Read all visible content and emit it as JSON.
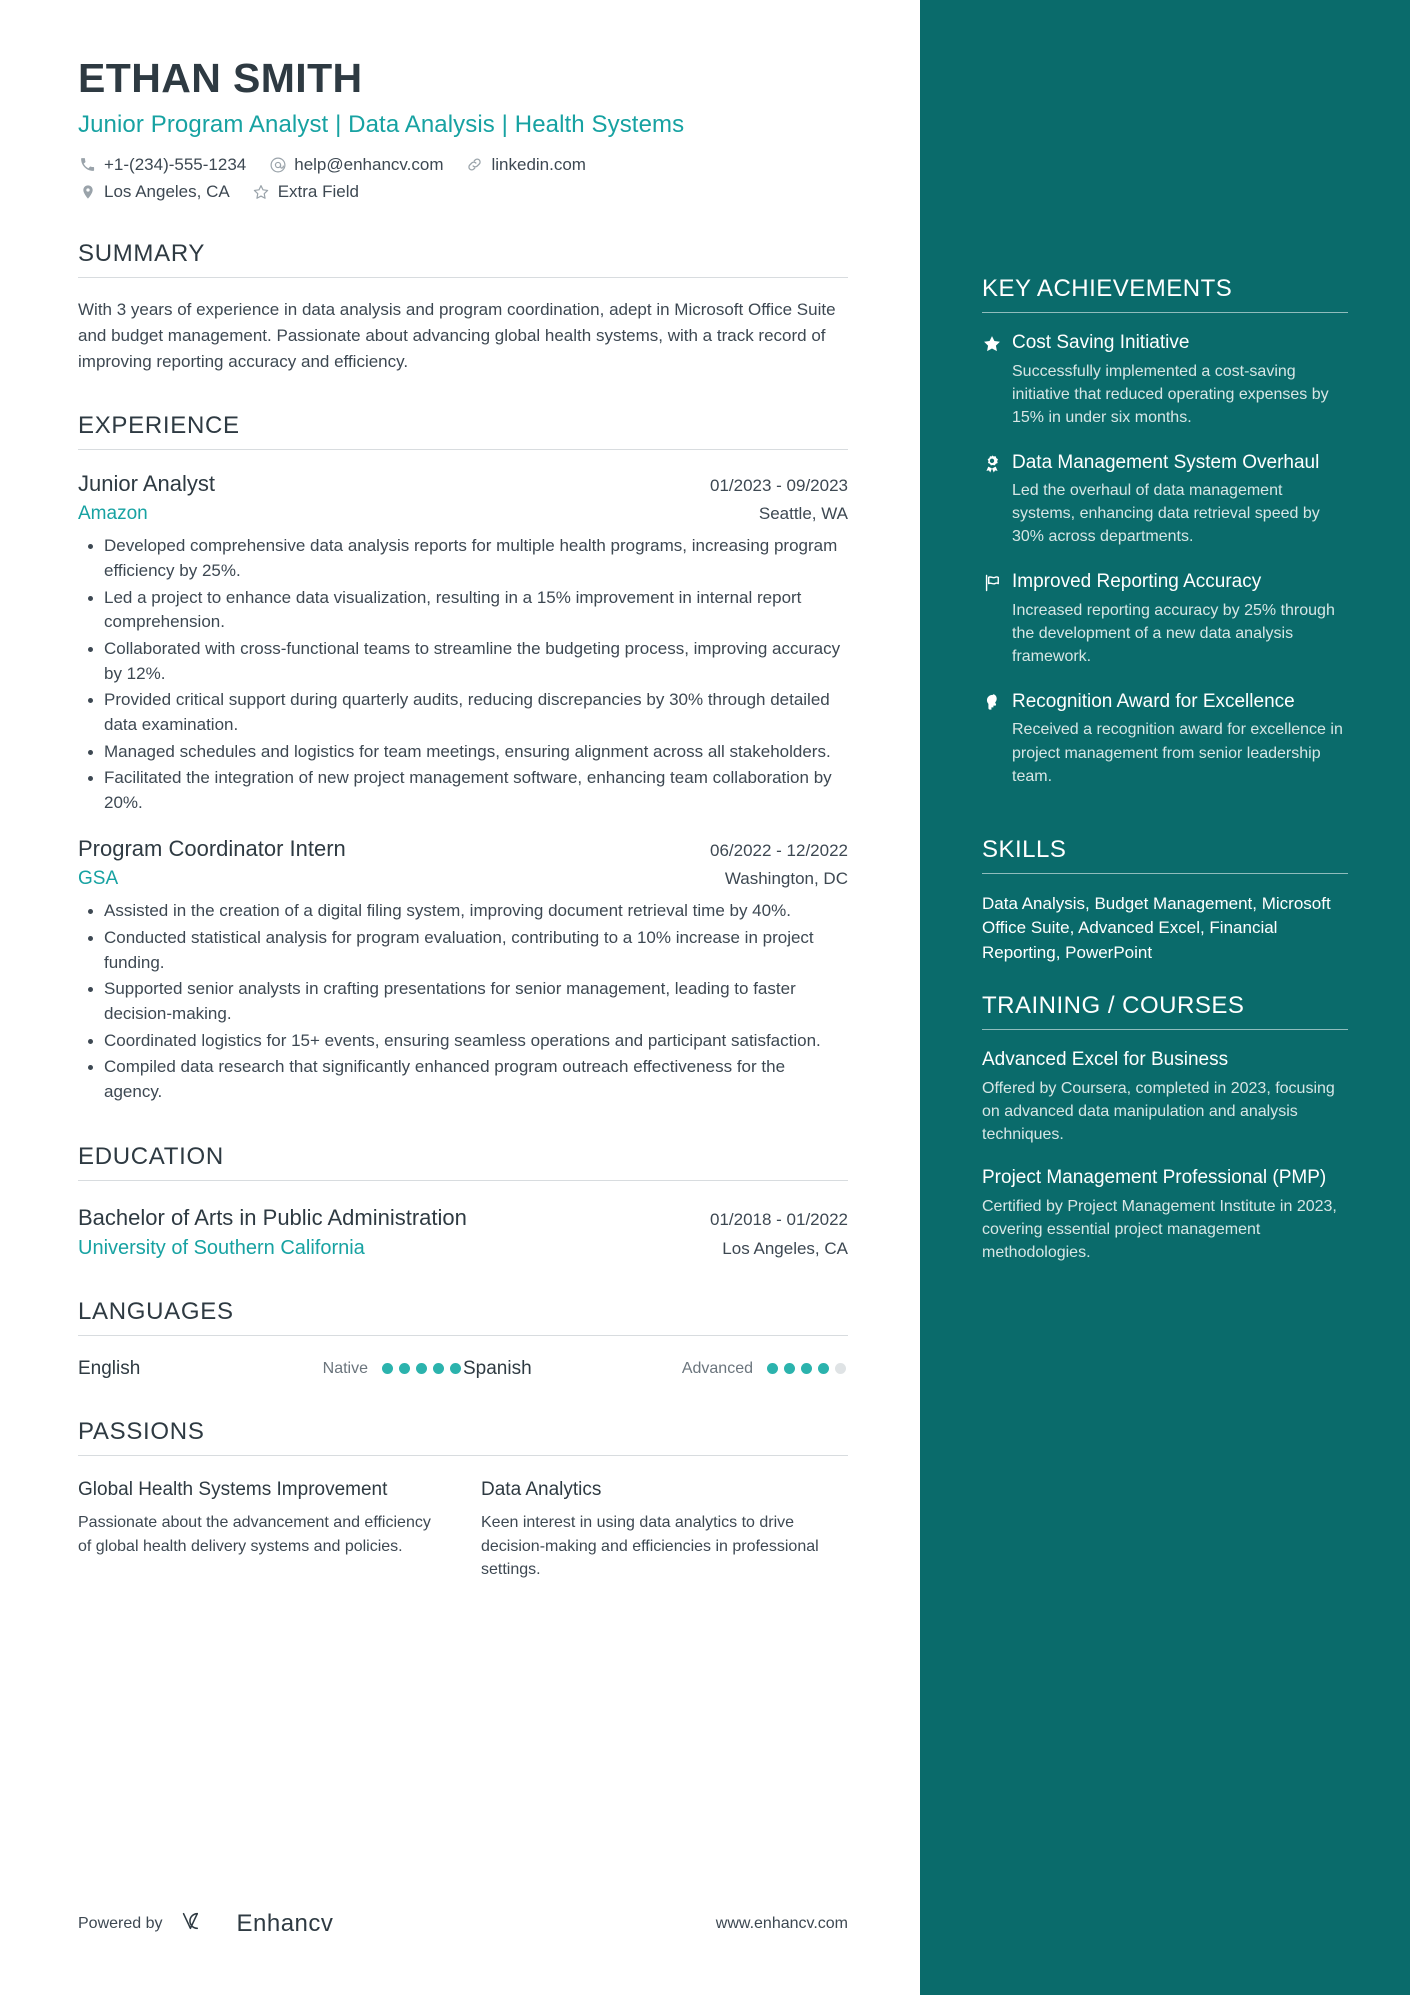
{
  "theme": {
    "accent": "#17a2a2",
    "sidebar_bg": "#0a6b6b",
    "text": "#3d4852",
    "heading": "#2e3a42",
    "dot_on": "#2bb3ad",
    "dot_off": "#dfe3e5"
  },
  "header": {
    "name": "ETHAN SMITH",
    "headline": "Junior Program Analyst | Data Analysis | Health Systems",
    "contacts_row1": [
      {
        "icon": "phone-icon",
        "text": "+1-(234)-555-1234"
      },
      {
        "icon": "email-icon",
        "text": "help@enhancv.com"
      },
      {
        "icon": "link-icon",
        "text": "linkedin.com"
      }
    ],
    "contacts_row2": [
      {
        "icon": "location-pin-icon",
        "text": "Los Angeles, CA"
      },
      {
        "icon": "star-outline-icon",
        "text": "Extra Field"
      }
    ]
  },
  "summary": {
    "title": "SUMMARY",
    "text": "With 3 years of experience in data analysis and program coordination, adept in Microsoft Office Suite and budget management. Passionate about advancing global health systems, with a track record of improving reporting accuracy and efficiency."
  },
  "experience": {
    "title": "EXPERIENCE",
    "jobs": [
      {
        "title": "Junior Analyst",
        "dates": "01/2023 - 09/2023",
        "company": "Amazon",
        "location": "Seattle, WA",
        "bullets": [
          "Developed comprehensive data analysis reports for multiple health programs, increasing program efficiency by 25%.",
          "Led a project to enhance data visualization, resulting in a 15% improvement in internal report comprehension.",
          "Collaborated with cross-functional teams to streamline the budgeting process, improving accuracy by 12%.",
          "Provided critical support during quarterly audits, reducing discrepancies by 30% through detailed data examination.",
          "Managed schedules and logistics for team meetings, ensuring alignment across all stakeholders.",
          "Facilitated the integration of new project management software, enhancing team collaboration by 20%."
        ]
      },
      {
        "title": "Program Coordinator Intern",
        "dates": "06/2022 - 12/2022",
        "company": "GSA",
        "location": "Washington, DC",
        "bullets": [
          "Assisted in the creation of a digital filing system, improving document retrieval time by 40%.",
          "Conducted statistical analysis for program evaluation, contributing to a 10% increase in project funding.",
          "Supported senior analysts in crafting presentations for senior management, leading to faster decision-making.",
          "Coordinated logistics for 15+ events, ensuring seamless operations and participant satisfaction.",
          "Compiled data research that significantly enhanced program outreach effectiveness for the agency."
        ]
      }
    ]
  },
  "education": {
    "title": "EDUCATION",
    "entries": [
      {
        "degree": "Bachelor of Arts in Public Administration",
        "dates": "01/2018 - 01/2022",
        "school": "University of Southern California",
        "location": "Los Angeles, CA"
      }
    ]
  },
  "languages": {
    "title": "LANGUAGES",
    "items": [
      {
        "name": "English",
        "level": "Native",
        "filled": 5,
        "total": 5
      },
      {
        "name": "Spanish",
        "level": "Advanced",
        "filled": 4,
        "total": 5
      }
    ]
  },
  "passions": {
    "title": "PASSIONS",
    "items": [
      {
        "title": "Global Health Systems Improvement",
        "desc": "Passionate about the advancement and efficiency of global health delivery systems and policies."
      },
      {
        "title": "Data Analytics",
        "desc": "Keen interest in using data analytics to drive decision-making and efficiencies in professional settings."
      }
    ]
  },
  "footer": {
    "powered_by": "Powered by",
    "brand": "Enhancv",
    "url": "www.enhancv.com"
  },
  "sidebar": {
    "achievements": {
      "title": "KEY ACHIEVEMENTS",
      "items": [
        {
          "icon": "star-filled-icon",
          "title": "Cost Saving Initiative",
          "desc": "Successfully implemented a cost-saving initiative that reduced operating expenses by 15% in under six months."
        },
        {
          "icon": "award-medal-icon",
          "title": "Data Management System Overhaul",
          "desc": "Led the overhaul of data management systems, enhancing data retrieval speed by 30% across departments."
        },
        {
          "icon": "flag-icon",
          "title": "Improved Reporting Accuracy",
          "desc": "Increased reporting accuracy by 25% through the development of a new data analysis framework."
        },
        {
          "icon": "head-profile-icon",
          "title": "Recognition Award for Excellence",
          "desc": "Received a recognition award for excellence in project management from senior leadership team."
        }
      ]
    },
    "skills": {
      "title": "SKILLS",
      "text": "Data Analysis, Budget Management, Microsoft Office Suite, Advanced Excel, Financial Reporting, PowerPoint"
    },
    "training": {
      "title": "TRAINING / COURSES",
      "items": [
        {
          "title": "Advanced Excel for Business",
          "desc": "Offered by Coursera, completed in 2023, focusing on advanced data manipulation and analysis techniques."
        },
        {
          "title": "Project Management Professional (PMP)",
          "desc": "Certified by Project Management Institute in 2023, covering essential project management methodologies."
        }
      ]
    }
  }
}
